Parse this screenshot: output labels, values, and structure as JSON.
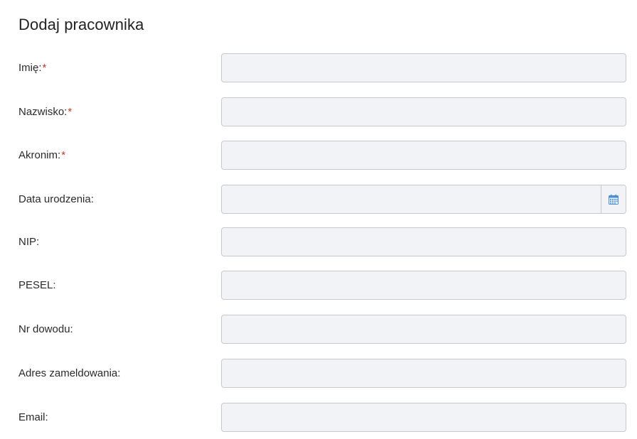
{
  "page": {
    "title": "Dodaj pracownika"
  },
  "form": {
    "required_mark": "*",
    "fields": [
      {
        "label": "Imię:",
        "value": "",
        "placeholder": "",
        "required": true
      },
      {
        "label": "Nazwisko:",
        "value": "",
        "placeholder": "",
        "required": true
      },
      {
        "label": "Akronim:",
        "value": "",
        "placeholder": "",
        "required": true
      },
      {
        "label": "Data urodzenia:",
        "value": "",
        "placeholder": "",
        "required": false,
        "icon": "calendar-icon"
      },
      {
        "label": "NIP:",
        "value": "",
        "placeholder": "",
        "required": false
      },
      {
        "label": "PESEL:",
        "value": "",
        "placeholder": "",
        "required": false
      },
      {
        "label": "Nr dowodu:",
        "value": "",
        "placeholder": "",
        "required": false
      },
      {
        "label": "Adres zameldowania:",
        "value": "",
        "placeholder": "",
        "required": false
      },
      {
        "label": "Email:",
        "value": "",
        "placeholder": "",
        "required": false
      }
    ]
  },
  "colors": {
    "required": "#c0392b",
    "input_background": "#f2f3f7",
    "input_border": "#c8c9ce",
    "calendar_icon": "#4a90d9"
  }
}
